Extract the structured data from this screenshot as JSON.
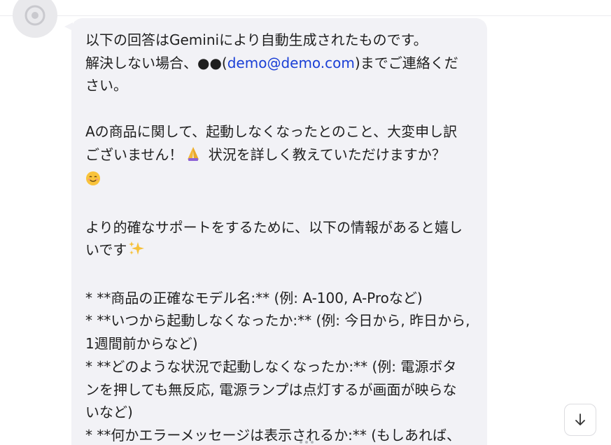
{
  "message": {
    "line_1": "以下の回答はGeminiにより自動生成されたものです。",
    "line_2_prefix": "解決しない場合、●●(",
    "line_2_email": "demo@demo.com",
    "line_2_suffix": ")までご連絡くだ",
    "line_3": "さい。",
    "line_5": "Aの商品に関して、起動しなくなったとのこと、大変申し訳",
    "line_6_prefix": "ございません！",
    "line_6_suffix": " 状況を詳しく教えていただけますか？",
    "line_9": "より的確なサポートをするために、以下の情報があると嬉し",
    "line_10": "いです",
    "line_12": "* **商品の正確なモデル名:** (例: A-100, A-Proなど)",
    "line_13": "* **いつから起動しなくなったか:** (例: 今日から, 昨日から,",
    "line_14": "1週間前からなど)",
    "line_15": "* **どのような状況で起動しなくなったか:** (例: 電源ボタ",
    "line_16": "ンを押しても無反応, 電源ランプは点灯するが画面が映らな",
    "line_17": "いなど)",
    "line_18": "* **何かエラーメッセージは表示されるか:** (もしあれば、"
  },
  "icons": {
    "avatar": "bot-avatar-icon",
    "pray": "folded-hands-emoji",
    "smile": "smiling-face-emoji",
    "sparkles": "sparkles-emoji",
    "scroll_down": "arrow-down-icon"
  },
  "colors": {
    "bubble": "#f2f2f6",
    "link": "#1a3fd6",
    "text": "#1f1f1f"
  }
}
